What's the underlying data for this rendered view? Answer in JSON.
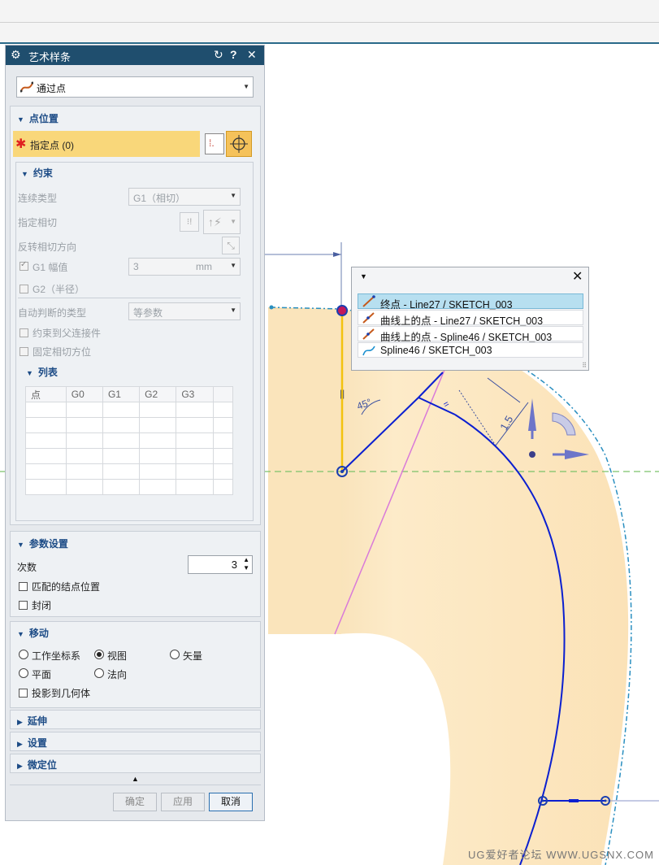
{
  "dialog": {
    "title": "艺术样条",
    "method": "通过点",
    "point_position": {
      "section": "点位置",
      "specify_point": "指定点 (0)"
    },
    "constraints": {
      "section": "约束",
      "continuity_type_label": "连续类型",
      "continuity_type_value": "G1（相切）",
      "specify_tangent_label": "指定相切",
      "reverse_tangent_label": "反转相切方向",
      "g1_magnitude_label": "G1 幅值",
      "g1_magnitude_value": "3",
      "g1_magnitude_unit": "mm",
      "g2_radius_label": "G2（半径）",
      "auto_infer_label": "自动判断的类型",
      "auto_infer_value": "等参数",
      "constrain_to_parent_label": "约束到父连接件",
      "fix_tangent_label": "固定相切方位",
      "list_section": "列表",
      "list_columns": [
        "点",
        "G0",
        "G1",
        "G2",
        "G3"
      ]
    },
    "parameters": {
      "section": "参数设置",
      "degree_label": "次数",
      "degree_value": "3",
      "match_knots_label": "匹配的结点位置",
      "closed_label": "封闭"
    },
    "move": {
      "section": "移动",
      "wcs_label": "工作坐标系",
      "view_label": "视图",
      "vector_label": "矢量",
      "plane_label": "平面",
      "normal_label": "法向",
      "project_label": "投影到几何体",
      "selected": "view"
    },
    "extend_section": "延伸",
    "settings_section": "设置",
    "fine_pos_section": "微定位",
    "buttons": {
      "ok": "确定",
      "apply": "应用",
      "cancel": "取消"
    }
  },
  "popup": {
    "items": [
      "终点 - Line27 / SKETCH_003",
      "曲线上的点 - Line27 / SKETCH_003",
      "曲线上的点 - Spline46 / SKETCH_003",
      "Spline46 / SKETCH_003"
    ],
    "selected_index": 0
  },
  "canvas": {
    "angle_dim": "45°",
    "length_dim": "1.5"
  },
  "watermark": "UG爱好者论坛 WWW.UGSNX.COM",
  "colors": {
    "title_bar": "#1f4e6e",
    "section_header": "#1d4c86",
    "highlight": "#f9d77a",
    "part_fill": "#fdebc9",
    "curve": "#0b1fd0"
  }
}
